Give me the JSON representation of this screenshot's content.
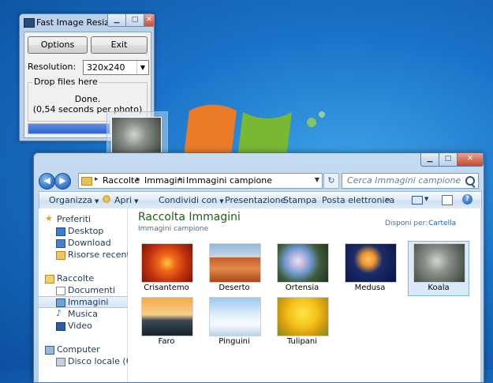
{
  "resizer": {
    "title": "Fast Image Resizer",
    "options_label": "Options",
    "exit_label": "Exit",
    "resolution_label": "Resolution:",
    "resolution_value": "320x240",
    "group_label": "Drop files here",
    "status_line1": "Done.",
    "status_line2": "(0,54 seconds per photo)",
    "progress_fraction": 0.68
  },
  "explorer": {
    "address": {
      "segments": [
        "Raccolte",
        "Immagini",
        "Immagini campione"
      ]
    },
    "search_placeholder": "Cerca Immagini campione",
    "commands": [
      "Organizza",
      "Apri",
      "Condividi con",
      "Presentazione",
      "Stampa",
      "Posta elettronica"
    ],
    "more": "»",
    "nav": {
      "favorites_header": "Preferiti",
      "favorites": [
        "Desktop",
        "Download",
        "Risorse recenti"
      ],
      "libraries_header": "Raccolte",
      "libraries": [
        "Documenti",
        "Immagini",
        "Musica",
        "Video"
      ],
      "computer_header": "Computer",
      "computer": [
        "Disco locale (C:)"
      ]
    },
    "library_title": "Raccolta Immagini",
    "library_subtitle": "Immagini campione",
    "arrange_label": "Disponi per:",
    "arrange_value": "Cartella",
    "thumbnails": [
      "Crisantemo",
      "Deserto",
      "Ortensia",
      "Medusa",
      "Koala",
      "Faro",
      "Pinguini",
      "Tulipani"
    ],
    "selected_thumbnail": "Koala"
  },
  "colors": {
    "accent": "#2462b4",
    "library_title": "#1e5f1a"
  }
}
